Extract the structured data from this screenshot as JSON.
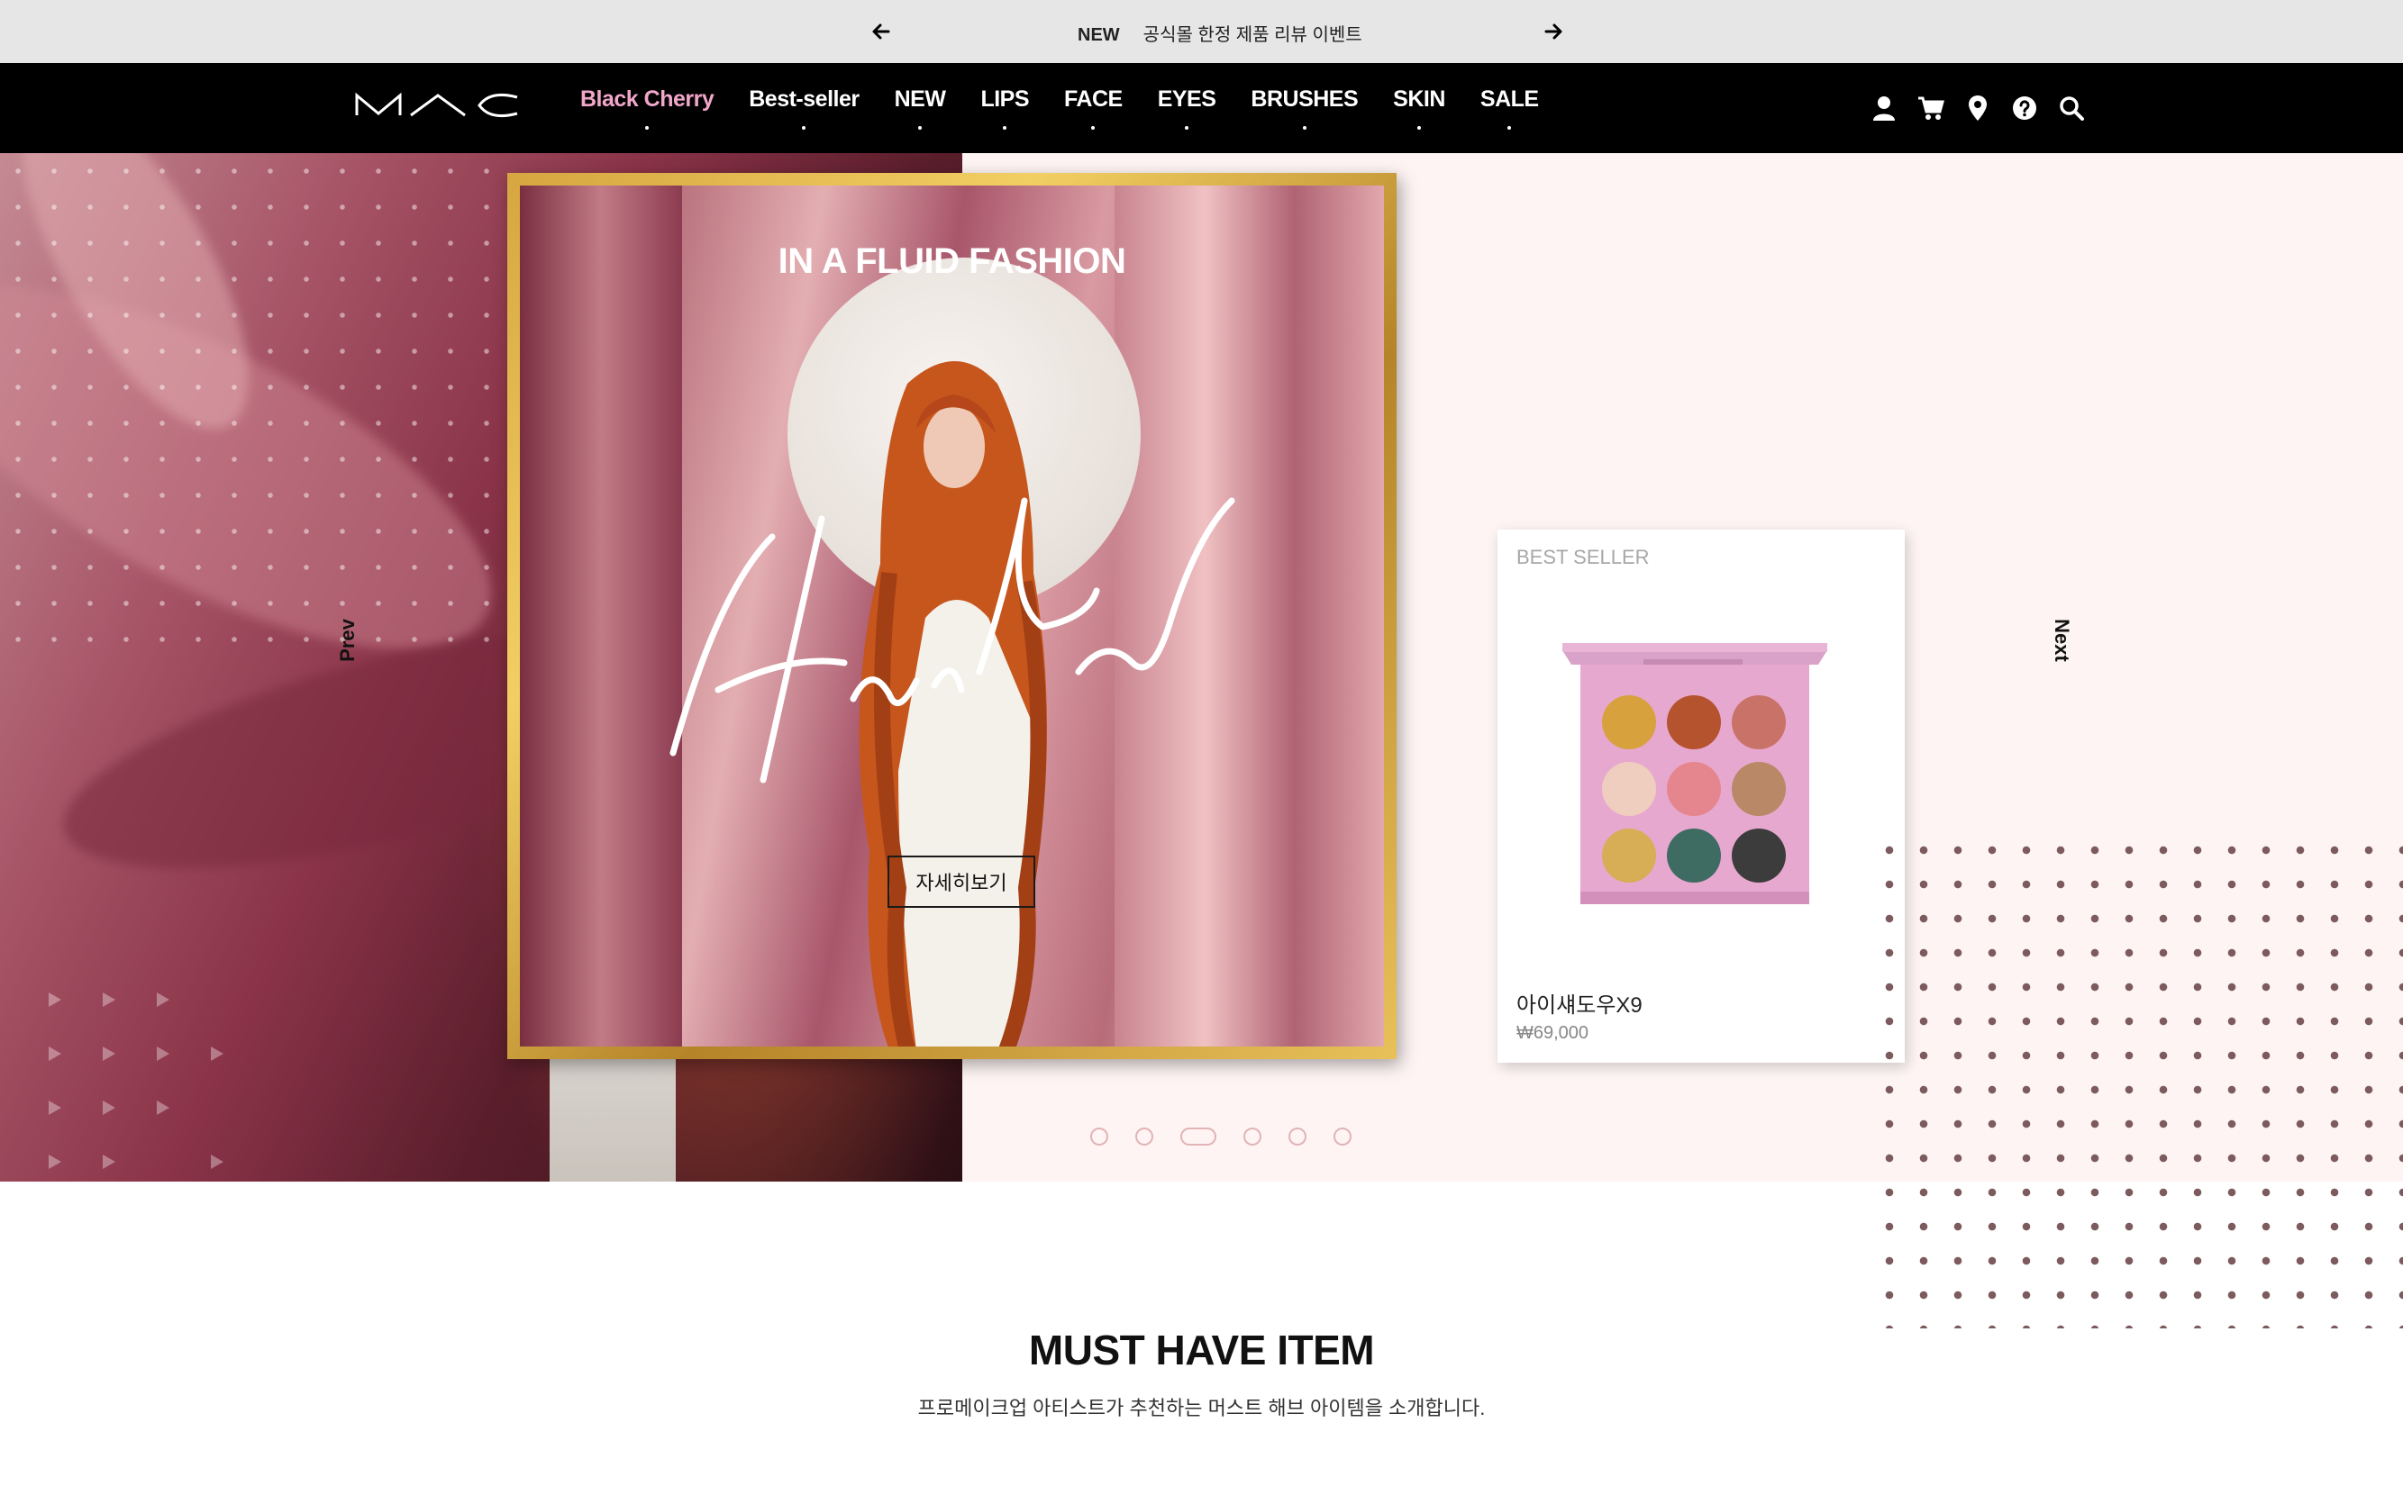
{
  "topbar": {
    "new_label": "NEW",
    "message": "공식몰 한정 제품 리뷰 이벤트"
  },
  "nav": {
    "logo": "MAC",
    "items": [
      {
        "label": "Black Cherry",
        "accent": true
      },
      {
        "label": "Best-seller"
      },
      {
        "label": "NEW"
      },
      {
        "label": "LIPS"
      },
      {
        "label": "FACE"
      },
      {
        "label": "EYES"
      },
      {
        "label": "BRUSHES"
      },
      {
        "label": "SKIN"
      },
      {
        "label": "SALE"
      }
    ],
    "utilities": [
      "user-icon",
      "cart-icon",
      "location-icon",
      "help-icon",
      "search-icon"
    ]
  },
  "hero": {
    "title": "IN A FLUID FASHION",
    "signature": "Harry Reed",
    "cta": "자세히보기",
    "prev": "Prev",
    "next": "Next",
    "slides_total": 6,
    "active_slide": 3
  },
  "product": {
    "tag": "BEST SELLER",
    "name": "아이섀도우X9",
    "price": "₩69,000",
    "swatches": [
      "#d7a13d",
      "#b5532f",
      "#c97267",
      "#efcdbf",
      "#e5868e",
      "#b98866",
      "#d7ad55",
      "#3e6b62",
      "#3c3c3c"
    ]
  },
  "must_have": {
    "title": "MUST HAVE ITEM",
    "subtitle": "프로메이크업 아티스트가 추천하는 머스트 해브 아이템을 소개합니다."
  },
  "colors": {
    "accent_pink": "#f1a7c9",
    "gold_frame": "#d6a640",
    "hero_bg": "#fdf4f3",
    "dot": "#7c5a5d"
  }
}
